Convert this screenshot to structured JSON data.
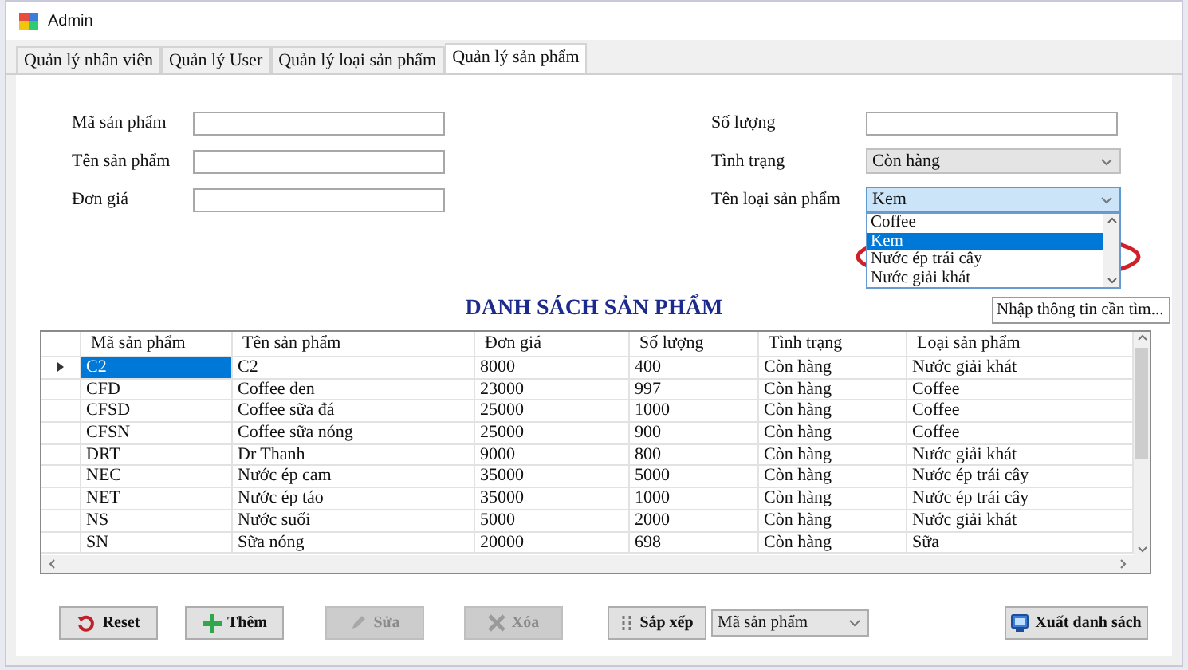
{
  "window": {
    "title": "Admin"
  },
  "tabs": [
    {
      "label": "Quản lý nhân viên",
      "selected": false
    },
    {
      "label": "Quản lý User",
      "selected": false
    },
    {
      "label": "Quản lý loại sản phẩm",
      "selected": false
    },
    {
      "label": "Quản lý sản phẩm",
      "selected": true
    }
  ],
  "form": {
    "left_fields": [
      {
        "label": "Mã sản phẩm"
      },
      {
        "label": "Tên sản phẩm"
      },
      {
        "label": "Đơn giá"
      }
    ],
    "quantity": {
      "label": "Số lượng"
    },
    "status": {
      "label": "Tình trạng",
      "value": "Còn hàng",
      "disabled": true
    },
    "category": {
      "label": "Tên loại sản phẩm",
      "value": "Kem",
      "expanded": true,
      "options": [
        {
          "label": "Coffee",
          "selected": false
        },
        {
          "label": "Kem",
          "selected": true
        },
        {
          "label": "Nước ép trái cây",
          "selected": false
        },
        {
          "label": "Nước giải khát",
          "selected": false
        }
      ]
    }
  },
  "list_title": "DANH SÁCH SẢN PHẨM",
  "search": {
    "placeholder": "Nhập thông tin cần tìm..."
  },
  "table": {
    "columns": [
      "Mã sản phẩm",
      "Tên sản phẩm",
      "Đơn giá",
      "Số lượng",
      "Tình trạng",
      "Loại sản phẩm"
    ],
    "rows": [
      {
        "cells": [
          "C2",
          "C2",
          "8000",
          "400",
          "Còn hàng",
          "Nước giải khát"
        ],
        "selected": true
      },
      {
        "cells": [
          "CFD",
          "Coffee đen",
          "23000",
          "997",
          "Còn hàng",
          "Coffee"
        ],
        "selected": false
      },
      {
        "cells": [
          "CFSD",
          "Coffee sữa đá",
          "25000",
          "1000",
          "Còn hàng",
          "Coffee"
        ],
        "selected": false
      },
      {
        "cells": [
          "CFSN",
          "Coffee sữa nóng",
          "25000",
          "900",
          "Còn hàng",
          "Coffee"
        ],
        "selected": false
      },
      {
        "cells": [
          "DRT",
          "Dr Thanh",
          "9000",
          "800",
          "Còn hàng",
          "Nước giải khát"
        ],
        "selected": false
      },
      {
        "cells": [
          "NEC",
          "Nước ép cam",
          "35000",
          "5000",
          "Còn hàng",
          "Nước ép trái cây"
        ],
        "selected": false
      },
      {
        "cells": [
          "NET",
          "Nước ép táo",
          "35000",
          "1000",
          "Còn hàng",
          "Nước ép trái cây"
        ],
        "selected": false
      },
      {
        "cells": [
          "NS",
          "Nước suối",
          "5000",
          "2000",
          "Còn hàng",
          "Nước giải khát"
        ],
        "selected": false
      },
      {
        "cells": [
          "SN",
          "Sữa nóng",
          "20000",
          "698",
          "Còn hàng",
          "Sữa"
        ],
        "selected": false
      }
    ]
  },
  "buttons": [
    {
      "label": "Reset",
      "kind": "reset",
      "disabled": false
    },
    {
      "label": "Thêm",
      "kind": "add",
      "disabled": false
    },
    {
      "label": "Sửa",
      "kind": "edit",
      "disabled": true
    },
    {
      "label": "Xóa",
      "kind": "delete",
      "disabled": true
    },
    {
      "label": "Sắp xếp",
      "kind": "sort",
      "disabled": false
    }
  ],
  "sort_by": {
    "value": "Mã sản phẩm"
  },
  "export_button": {
    "label": "Xuất danh sách"
  }
}
